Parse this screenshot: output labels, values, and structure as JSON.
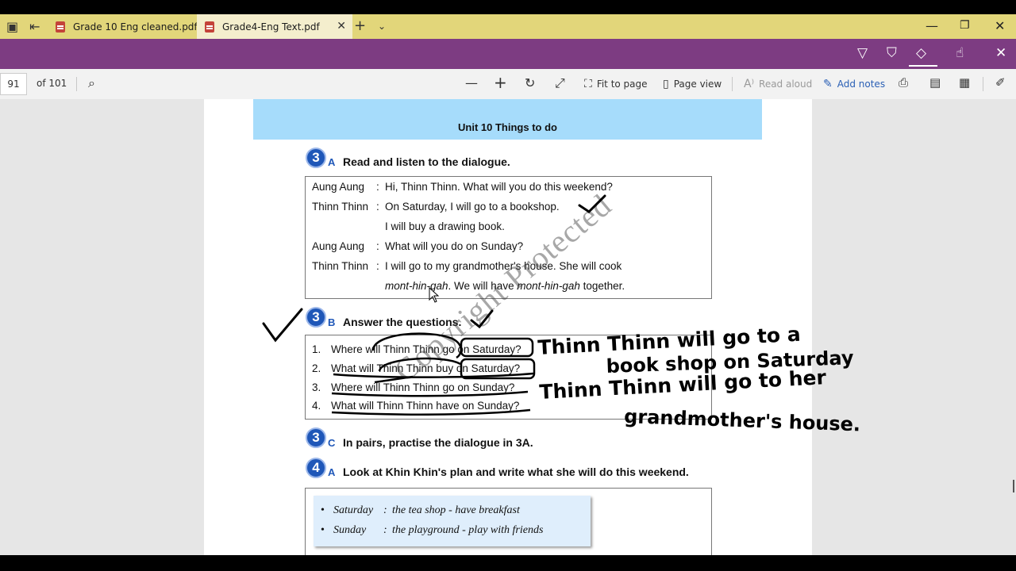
{
  "tabs": [
    {
      "label": "Grade 10 Eng cleaned.pdf",
      "active": false
    },
    {
      "label": "Grade4-Eng Text.pdf",
      "active": true
    }
  ],
  "tabstrip_icons": [
    "close-icon",
    "plus-icon",
    "chevron-down-icon"
  ],
  "window_icons": [
    "minimize-icon",
    "restore-icon",
    "close-icon"
  ],
  "ink_toolbar_icons": [
    "ballpoint-pen-icon",
    "highlighter-icon",
    "eraser-icon",
    "touch-writing-icon",
    "close-icon"
  ],
  "toolbar": {
    "page_number": "91",
    "page_total": "of 101",
    "fit_to_page": "Fit to page",
    "page_view": "Page view",
    "read_aloud": "Read aloud",
    "add_notes": "Add notes"
  },
  "colors": {
    "tab_bar": "#e2d67a",
    "active_tab": "#f4eecd",
    "ink_bar": "#7d3c82",
    "unit_band": "#a6dcfb",
    "badge": "#1f57b8",
    "link_blue": "#2a5fb5"
  },
  "document": {
    "unit_title": "Unit 10 Things to do",
    "section_3a": {
      "number": "3",
      "letter": "A",
      "heading": "Read and listen to the dialogue."
    },
    "dialogue": [
      {
        "speaker": "Aung Aung",
        "colon": ":",
        "text": "Hi, Thinn Thinn. What will you do this weekend?"
      },
      {
        "speaker": "Thinn Thinn",
        "colon": ":",
        "text": "On Saturday, I will go to a bookshop."
      },
      {
        "speaker": "",
        "colon": "",
        "text": "I will buy a drawing book."
      },
      {
        "speaker": "Aung Aung",
        "colon": ":",
        "text": "What will you do on Sunday?"
      },
      {
        "speaker": "Thinn Thinn",
        "colon": ":",
        "text": "I will go to my grandmother's house. She will cook"
      },
      {
        "speaker": "",
        "colon": "",
        "text": "mont-hin-gah",
        "text2": ". We will have ",
        "text3": "mont-hin-gah",
        "text4": " together."
      }
    ],
    "section_3b": {
      "number": "3",
      "letter": "B",
      "heading": "Answer the questions."
    },
    "questions": [
      {
        "num": "1.",
        "text": "Where will Thinn Thinn go on Saturday?"
      },
      {
        "num": "2.",
        "text": "What will Thinn Thinn buy on Saturday?"
      },
      {
        "num": "3.",
        "text": "Where will Thinn Thinn go on Sunday?"
      },
      {
        "num": "4.",
        "text": "What will Thinn Thinn have on Sunday?"
      }
    ],
    "section_3c": {
      "number": "3",
      "letter": "C",
      "heading": "In pairs, practise the dialogue in 3A."
    },
    "section_4a": {
      "number": "4",
      "letter": "A",
      "heading": "Look at Khin Khin's plan and write what she will do this weekend."
    },
    "plan": [
      {
        "day": "Saturday",
        "colon": ":",
        "text": "the tea shop - have breakfast"
      },
      {
        "day": "Sunday",
        "colon": ":",
        "text": "the playground - play with friends"
      }
    ],
    "watermark": "Copyright Protected"
  },
  "handwriting": {
    "line1": "Thinn Thinn will go to a",
    "line2": "book shop on Saturday",
    "line3": "Thinn Thinn will go to her",
    "line4": "grandmother's house."
  }
}
